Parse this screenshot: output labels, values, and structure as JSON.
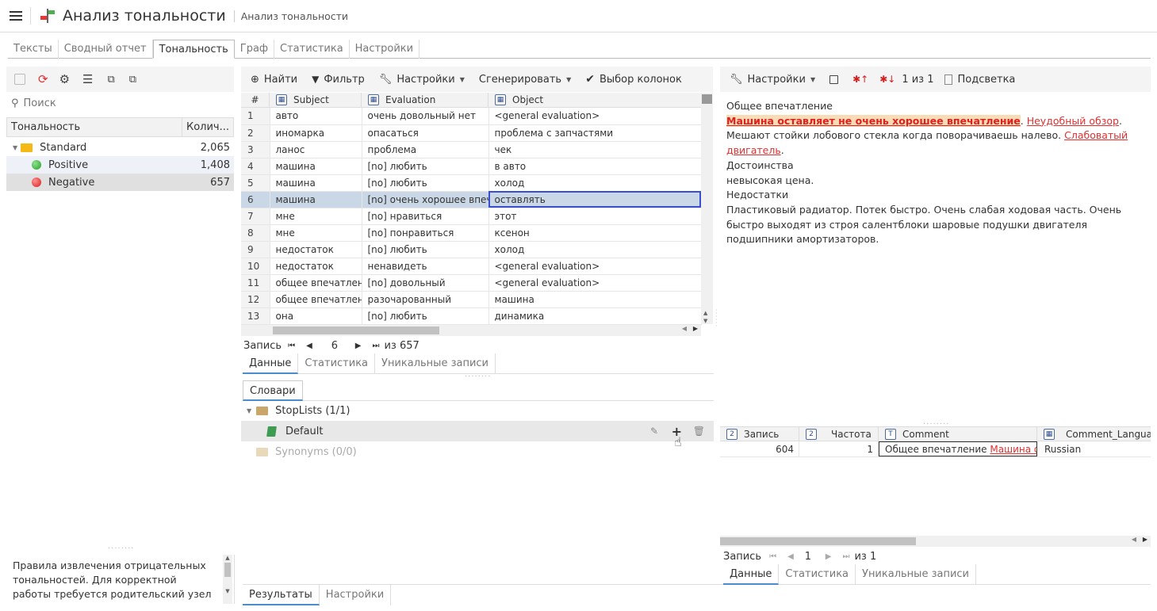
{
  "app": {
    "title": "Анализ тональности",
    "subtitle": "Анализ тональности"
  },
  "main_tabs": [
    "Тексты",
    "Сводный отчет",
    "Тональность",
    "Граф",
    "Статистика",
    "Настройки"
  ],
  "left": {
    "search_placeholder": "Поиск",
    "col_name": "Тональность",
    "col_count": "Колич...",
    "tree": [
      {
        "label": "Standard",
        "count": "2,065"
      },
      {
        "label": "Positive",
        "count": "1,408"
      },
      {
        "label": "Negative",
        "count": "657"
      }
    ],
    "description": "Правила извлечения отрицательных тональностей. Для корректной работы требуется родительский узел",
    "bottom_tabs": [
      "Результаты",
      "Настройки"
    ]
  },
  "mid": {
    "toolbar": {
      "find": "Найти",
      "filter": "Фильтр",
      "settings": "Настройки",
      "generate": "Сгенерировать",
      "columns": "Выбор колонок"
    },
    "headers": [
      "#",
      "Subject",
      "Evaluation",
      "Object"
    ],
    "rows": [
      [
        "1",
        "авто",
        "очень довольный нет",
        "<general evaluation>"
      ],
      [
        "2",
        "иномарка",
        "опасаться",
        "проблема с запчастями"
      ],
      [
        "3",
        "ланос",
        "проблема",
        "чек"
      ],
      [
        "4",
        "машина",
        "[no] любить",
        "в авто"
      ],
      [
        "5",
        "машина",
        "[no] любить",
        "холод"
      ],
      [
        "6",
        "машина",
        "[no] очень хорошее впечатл",
        "оставлять"
      ],
      [
        "7",
        "мне",
        "[no] нравиться",
        "этот"
      ],
      [
        "8",
        "мне",
        "[no] понравиться",
        "ксенон"
      ],
      [
        "9",
        "недостаток",
        "[no] любить",
        "холод"
      ],
      [
        "10",
        "недостаток",
        "ненавидеть",
        "<general evaluation>"
      ],
      [
        "11",
        "общее впечатлен",
        "[no] довольный",
        "<general evaluation>"
      ],
      [
        "12",
        "общее впечатлен",
        "разочарованный",
        "машина"
      ],
      [
        "13",
        "она",
        "[no] любить",
        "динамика"
      ]
    ],
    "pager": {
      "label": "Запись",
      "current": "6",
      "total": "из 657"
    },
    "data_tabs": [
      "Данные",
      "Статистика",
      "Уникальные записи"
    ],
    "dict_tab": "Словари",
    "dict": {
      "stoplists": "StopLists (1/1)",
      "default": "Default",
      "synonyms": "Synonyms (0/0)"
    }
  },
  "right": {
    "toolbar": {
      "settings": "Настройки",
      "count": "1 из 1",
      "highlight": "Подсветка"
    },
    "text": {
      "p1": "Общее впечатление",
      "hl": "Машина оставляет не очень хорошее впечатление",
      "dot1": ".",
      "link1": "Неудобный обзор",
      "dot2": ".",
      "p2": "Мешают стойки лобового стекла когда поворачиваешь налево.",
      "link2": "Слабоватый двигатель",
      "dot3": ".",
      "p3": "Достоинства",
      "p4": "невысокая цена.",
      "p5": "Недостатки",
      "p6": "Пластиковый радиатор. Потек быстро. Очень слабая ходовая часть. Очень быстро выходят из строя салентблоки шаровые подушки двигателя подшипники амортизаторов."
    },
    "grid": {
      "headers": [
        "Запись",
        "Частота",
        "Comment",
        "Comment_Langua..."
      ],
      "row": {
        "rec": "604",
        "freq": "1",
        "comment_plain": "Общее впечатление",
        "comment_link": "Машина ос",
        "lang": "Russian"
      }
    },
    "pager": {
      "label": "Запись",
      "current": "1",
      "total": "из 1"
    },
    "data_tabs": [
      "Данные",
      "Статистика",
      "Уникальные записи"
    ]
  }
}
